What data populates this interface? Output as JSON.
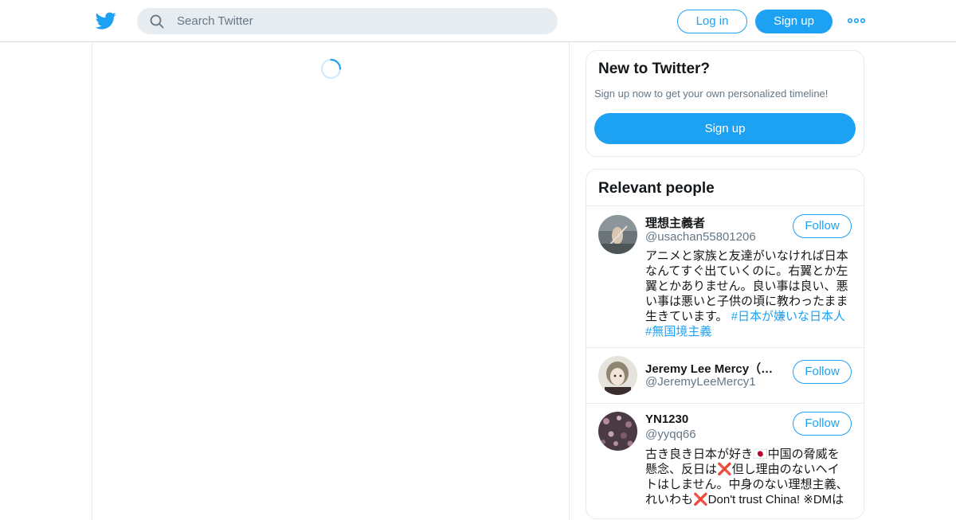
{
  "header": {
    "search_placeholder": "Search Twitter",
    "login_label": "Log in",
    "signup_label": "Sign up"
  },
  "signup_card": {
    "title": "New to Twitter?",
    "subtitle": "Sign up now to get your own personalized timeline!",
    "button_label": "Sign up"
  },
  "people_card": {
    "title": "Relevant people",
    "people": [
      {
        "name": "理想主義者",
        "handle": "@usachan55801206",
        "follow_label": "Follow",
        "bio_text": "アニメと家族と友達がいなければ日本なんてすぐ出ていくのに。右翼とか左翼とかありません。良い事は良い、悪い事は悪いと子供の頃に教わったまま生きています。",
        "bio_tag1": "#日本が嫌いな日本人",
        "bio_tag2": "#無国境主義"
      },
      {
        "name": "Jeremy Lee Mercy（人...",
        "handle": "@JeremyLeeMercy1",
        "follow_label": "Follow"
      },
      {
        "name": "YN1230",
        "handle": "@yyqq66",
        "follow_label": "Follow",
        "bio_line1": "古き良き日本が好き🇯🇵中国の脅威を",
        "bio_line2": "懸念、反日は❌但し理由のないヘイ",
        "bio_line3": "トはしません。中身のない理想主義、",
        "bio_line4": "れいわも❌Don't trust China! ※DMは"
      }
    ]
  },
  "colors": {
    "accent": "#1da1f2",
    "secondary_text": "#657786",
    "border": "#e6ecf0"
  }
}
